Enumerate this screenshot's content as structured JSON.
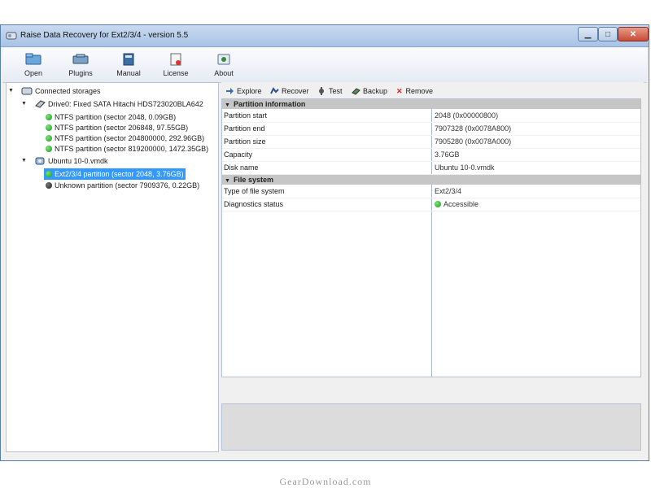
{
  "window": {
    "title": "Raise Data Recovery for Ext2/3/4 - version 5.5"
  },
  "toolbar": {
    "buttons": [
      {
        "label": "Open",
        "icon": "open-folder-icon"
      },
      {
        "label": "Plugins",
        "icon": "plugins-icon"
      },
      {
        "label": "Manual",
        "icon": "manual-book-icon"
      },
      {
        "label": "License",
        "icon": "license-icon"
      },
      {
        "label": "About",
        "icon": "about-icon"
      }
    ]
  },
  "tree": {
    "root": "Connected storages",
    "drive0": {
      "label": "Drive0: Fixed SATA Hitachi HDS723020BLA642",
      "partitions": [
        "NTFS partition (sector 2048, 0.09GB)",
        "NTFS partition (sector 206848, 97.55GB)",
        "NTFS partition (sector 204800000, 292.96GB)",
        "NTFS partition (sector 819200000, 1472.35GB)"
      ]
    },
    "vmdk": {
      "label": "Ubuntu 10-0.vmdk",
      "partitions": [
        "Ext2/3/4 partition (sector 2048, 3.76GB)",
        "Unknown partition (sector 7909376, 0.22GB)"
      ]
    }
  },
  "actions": [
    "Explore",
    "Recover",
    "Test",
    "Backup",
    "Remove"
  ],
  "properties": {
    "partition_section": "Partition information",
    "partition_rows": [
      {
        "key": "Partition start",
        "value": "2048 (0x00000800)"
      },
      {
        "key": "Partition end",
        "value": "7907328 (0x0078A800)"
      },
      {
        "key": "Partition size",
        "value": "7905280 (0x0078A000)"
      },
      {
        "key": "Capacity",
        "value": "3.76GB"
      },
      {
        "key": "Disk name",
        "value": "Ubuntu 10-0.vmdk"
      }
    ],
    "fs_section": "File system",
    "fs_rows": [
      {
        "key": "Type of file system",
        "value": "Ext2/3/4"
      },
      {
        "key": "Diagnostics status",
        "value": "Accessible"
      }
    ]
  },
  "watermark": "GearDownload.com",
  "colors": {
    "status_green": "#11a011",
    "selection": "#3399ff",
    "section_header": "#c6c6c6"
  }
}
